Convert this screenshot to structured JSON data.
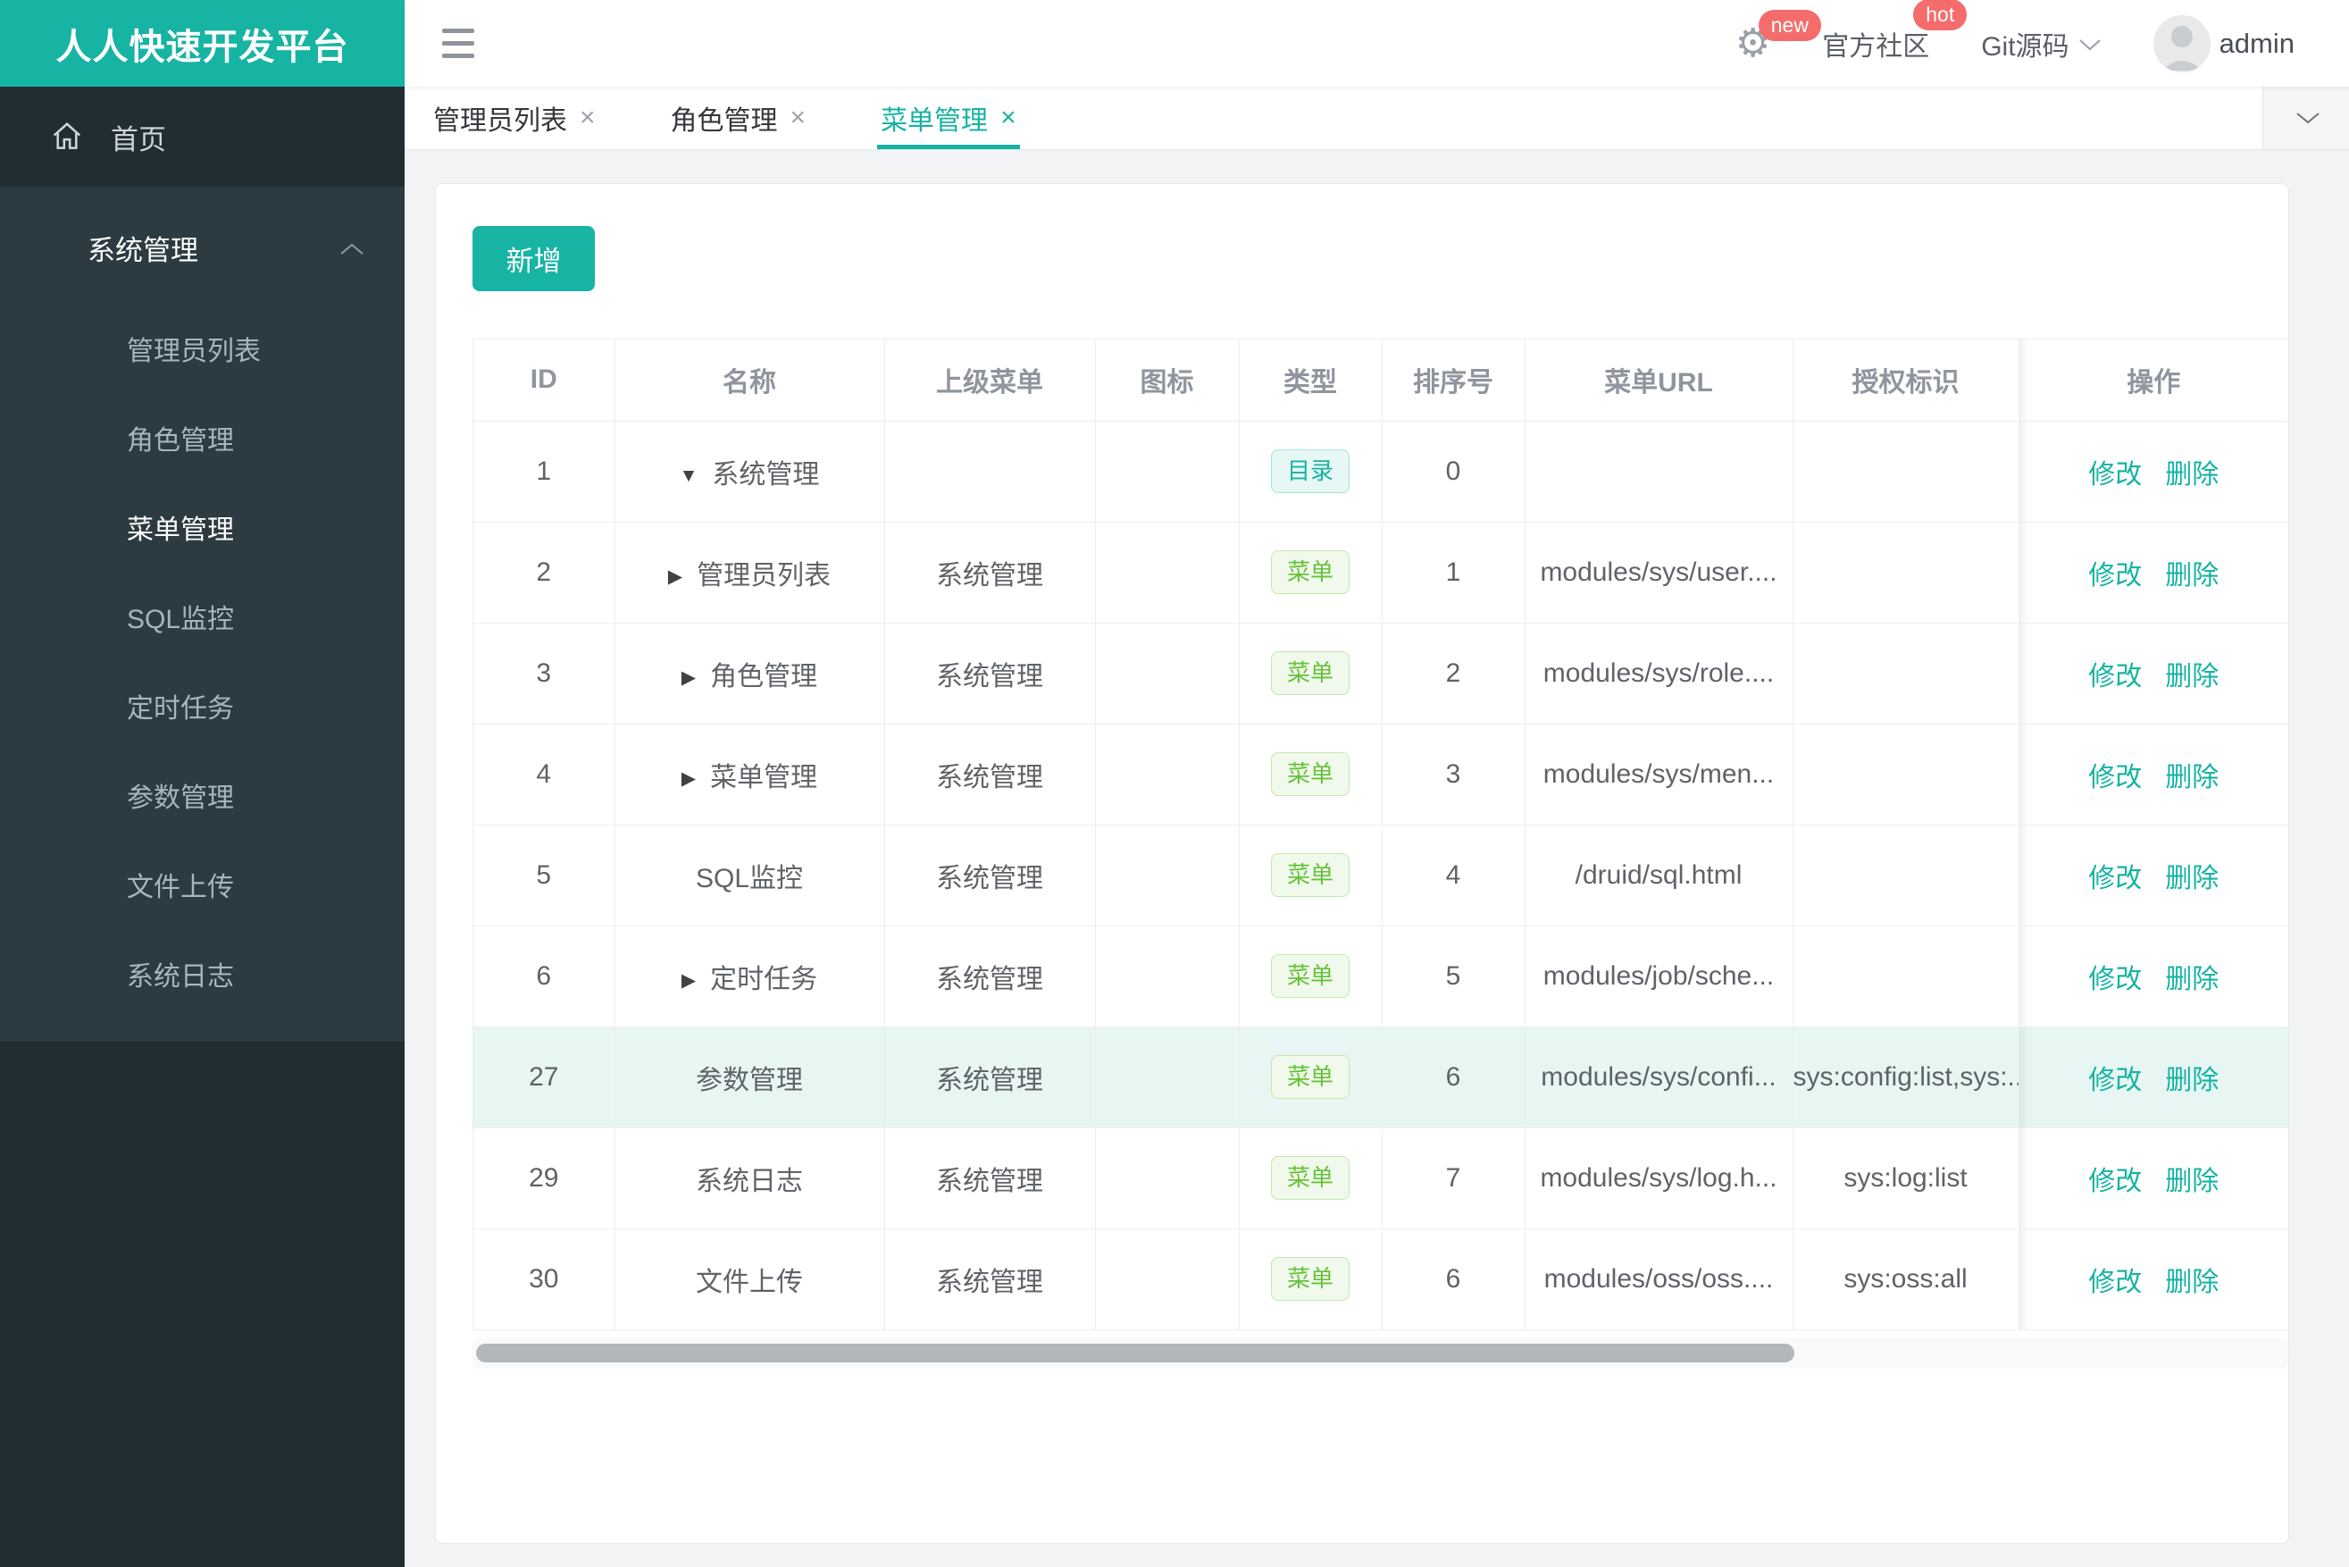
{
  "brand": {
    "title": "人人快速开发平台",
    "color": "#17b3a3"
  },
  "header": {
    "badge_new": "new",
    "badge_hot": "hot",
    "community_label": "官方社区",
    "git_label": "Git源码",
    "username": "admin",
    "badge_color": "#f56c6c"
  },
  "tabs": [
    {
      "label": "管理员列表",
      "close": "×",
      "active": false
    },
    {
      "label": "角色管理",
      "close": "×",
      "active": false
    },
    {
      "label": "菜单管理",
      "close": "×",
      "active": true
    }
  ],
  "sidebar": {
    "home_label": "首页",
    "group_label": "系统管理",
    "items": [
      {
        "label": "管理员列表",
        "active": false
      },
      {
        "label": "角色管理",
        "active": false
      },
      {
        "label": "菜单管理",
        "active": true
      },
      {
        "label": "SQL监控",
        "active": false
      },
      {
        "label": "定时任务",
        "active": false
      },
      {
        "label": "参数管理",
        "active": false
      },
      {
        "label": "文件上传",
        "active": false
      },
      {
        "label": "系统日志",
        "active": false
      }
    ]
  },
  "toolbar": {
    "add_label": "新增"
  },
  "table": {
    "columns": [
      "ID",
      "名称",
      "上级菜单",
      "图标",
      "类型",
      "排序号",
      "菜单URL",
      "授权标识",
      "操作"
    ],
    "actions": {
      "edit": "修改",
      "delete": "删除"
    },
    "rows": [
      {
        "id": "1",
        "arrow": "down",
        "name": "系统管理",
        "parent": "",
        "icon": "",
        "type_label": "目录",
        "type_kind": "dir",
        "order": "0",
        "url": "",
        "perms": "",
        "highlight": false
      },
      {
        "id": "2",
        "arrow": "right",
        "name": "管理员列表",
        "parent": "系统管理",
        "icon": "",
        "type_label": "菜单",
        "type_kind": "menu",
        "order": "1",
        "url": "modules/sys/user....",
        "perms": "",
        "highlight": false
      },
      {
        "id": "3",
        "arrow": "right",
        "name": "角色管理",
        "parent": "系统管理",
        "icon": "",
        "type_label": "菜单",
        "type_kind": "menu",
        "order": "2",
        "url": "modules/sys/role....",
        "perms": "",
        "highlight": false
      },
      {
        "id": "4",
        "arrow": "right",
        "name": "菜单管理",
        "parent": "系统管理",
        "icon": "",
        "type_label": "菜单",
        "type_kind": "menu",
        "order": "3",
        "url": "modules/sys/men...",
        "perms": "",
        "highlight": false
      },
      {
        "id": "5",
        "arrow": "",
        "name": "SQL监控",
        "parent": "系统管理",
        "icon": "",
        "type_label": "菜单",
        "type_kind": "menu",
        "order": "4",
        "url": "/druid/sql.html",
        "perms": "",
        "highlight": false
      },
      {
        "id": "6",
        "arrow": "right",
        "name": "定时任务",
        "parent": "系统管理",
        "icon": "",
        "type_label": "菜单",
        "type_kind": "menu",
        "order": "5",
        "url": "modules/job/sche...",
        "perms": "",
        "highlight": false
      },
      {
        "id": "27",
        "arrow": "",
        "name": "参数管理",
        "parent": "系统管理",
        "icon": "",
        "type_label": "菜单",
        "type_kind": "menu",
        "order": "6",
        "url": "modules/sys/confi...",
        "perms": "sys:config:list,sys:...",
        "highlight": true
      },
      {
        "id": "29",
        "arrow": "",
        "name": "系统日志",
        "parent": "系统管理",
        "icon": "",
        "type_label": "菜单",
        "type_kind": "menu",
        "order": "7",
        "url": "modules/sys/log.h...",
        "perms": "sys:log:list",
        "highlight": false
      },
      {
        "id": "30",
        "arrow": "",
        "name": "文件上传",
        "parent": "系统管理",
        "icon": "",
        "type_label": "菜单",
        "type_kind": "menu",
        "order": "6",
        "url": "modules/oss/oss....",
        "perms": "sys:oss:all",
        "highlight": false
      }
    ]
  }
}
